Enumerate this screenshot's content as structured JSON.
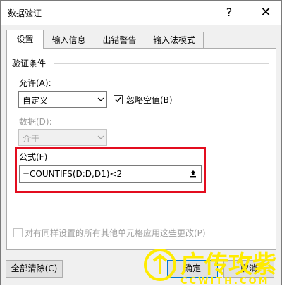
{
  "window": {
    "title": "数据验证",
    "help_label": "?",
    "close_label": "✕"
  },
  "tabs": [
    {
      "label": "设置",
      "active": true
    },
    {
      "label": "输入信息",
      "active": false
    },
    {
      "label": "出错警告",
      "active": false
    },
    {
      "label": "输入法模式",
      "active": false
    }
  ],
  "validation": {
    "section_title": "验证条件",
    "allow_label": "允许(A):",
    "allow_value": "自定义",
    "ignore_blank_label": "忽略空值(B)",
    "ignore_blank_checked": true,
    "data_label": "数据(D):",
    "data_value": "介于",
    "formula_label": "公式(F)",
    "formula_value": "=COUNTIFS(D:D,D1)<2"
  },
  "apply_all_label": "对有同样设置的所有其他单元格应用这些更改(P)",
  "buttons": {
    "clear_all": "全部清除(C)",
    "ok": "确定",
    "cancel": "取消"
  },
  "watermark": {
    "text": "广传攻紫",
    "subtext": "CCWITH.COM"
  },
  "colors": {
    "highlight": "#e30d1f",
    "watermark": "#ffeb00"
  },
  "icons": {
    "dropdown": "chevron-down-icon",
    "collapse_ref": "upload-arrow-icon",
    "checkmark": "checkmark-icon"
  }
}
